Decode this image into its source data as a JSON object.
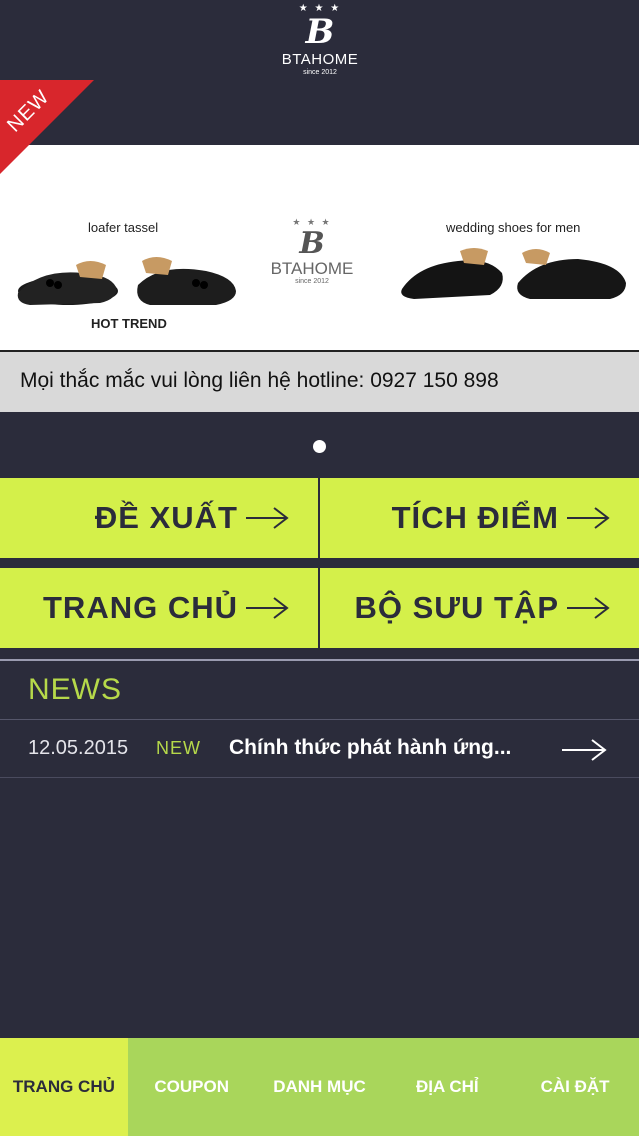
{
  "header": {
    "logo_stars": "★ ★ ★",
    "logo_monogram": "B",
    "logo_brand": "BTAHOME",
    "logo_since": "since 2012",
    "ribbon_tag": "NEW"
  },
  "banner": {
    "left_caption": "loafer tassel",
    "left_subcaption": "HOT TREND",
    "right_caption": "wedding shoes for men",
    "center_logo_stars": "★ ★ ★",
    "center_logo_monogram": "B",
    "center_logo_brand": "BTAHOME",
    "center_logo_since": "since 2012"
  },
  "hotline": {
    "text": "Mọi thắc mắc vui lòng liên hệ hotline: 0927 150 898"
  },
  "menu": {
    "recommend": "ĐỀ XUẤT",
    "points": "TÍCH ĐIỂM",
    "home": "TRANG CHỦ",
    "collection": "BỘ SƯU TẬP"
  },
  "news": {
    "title": "NEWS",
    "items": [
      {
        "date": "12.05.2015",
        "tag": "NEW",
        "headline": "Chính thức phát hành ứng..."
      }
    ]
  },
  "tabs": [
    {
      "label": "TRANG CHỦ",
      "active": true
    },
    {
      "label": "COUPON",
      "active": false
    },
    {
      "label": "DANH MỤC",
      "active": false
    },
    {
      "label": "ĐỊA CHỈ",
      "active": false
    },
    {
      "label": "CÀI ĐẶT",
      "active": false
    }
  ],
  "colors": {
    "background": "#2b2c3b",
    "tile_green": "#d4f04a",
    "news_green": "#b6d94a",
    "tabbar_green": "#a9d65b",
    "ribbon_red": "#d8262c"
  }
}
